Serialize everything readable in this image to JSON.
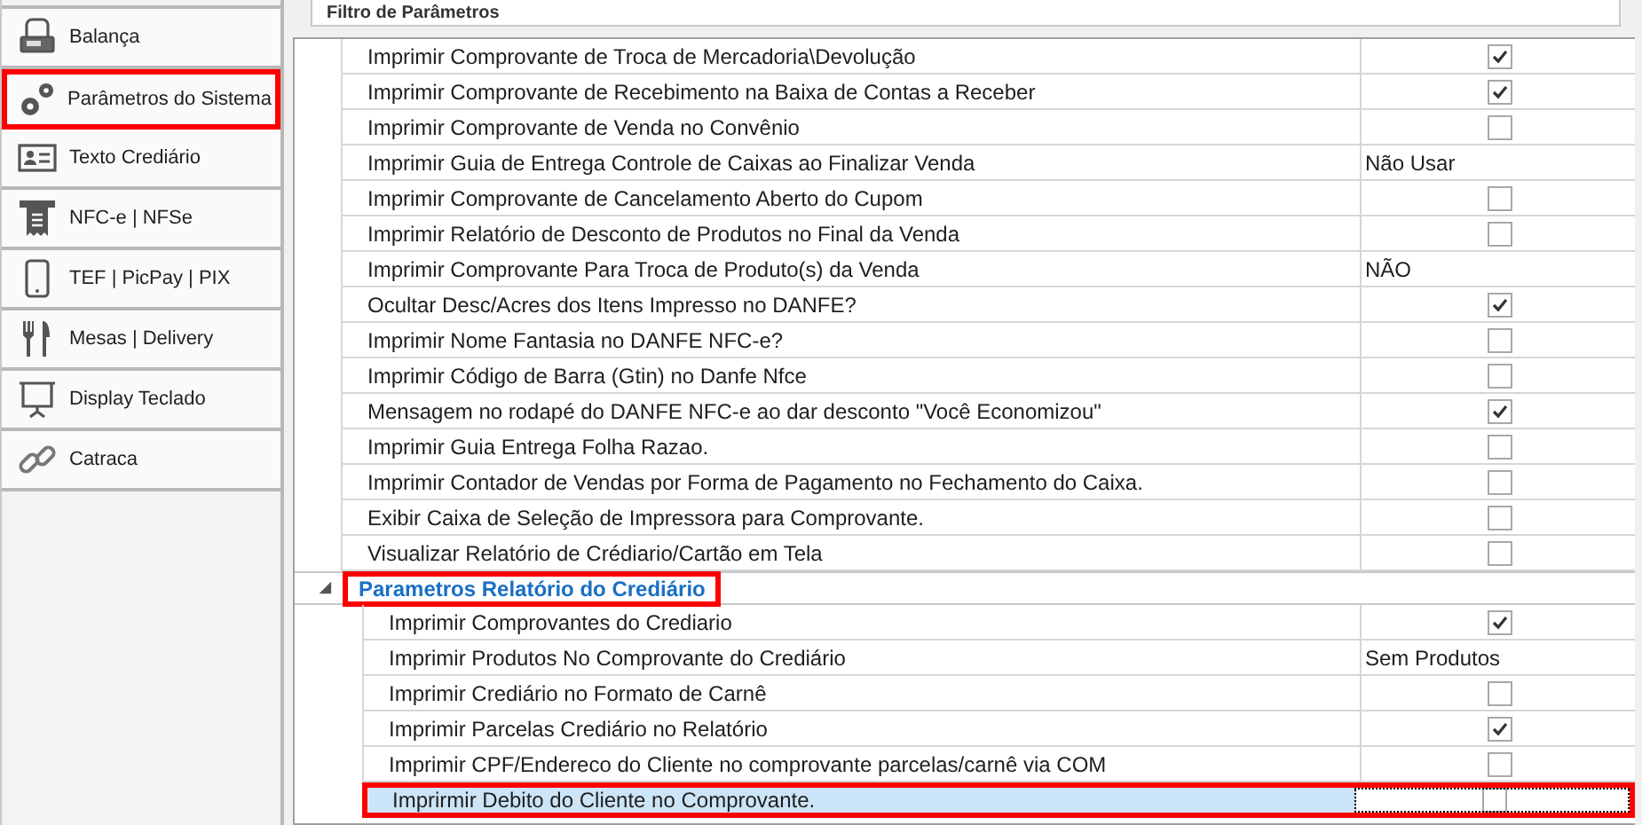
{
  "sidebar": {
    "items": [
      {
        "label": "Balança",
        "highlighted": false
      },
      {
        "label": "Parâmetros do Sistema",
        "highlighted": true
      },
      {
        "label": "Texto Crediário",
        "highlighted": false
      },
      {
        "label": "NFC-e | NFSe",
        "highlighted": false
      },
      {
        "label": "TEF | PicPay | PIX",
        "highlighted": false
      },
      {
        "label": "Mesas | Delivery",
        "highlighted": false
      },
      {
        "label": "Display Teclado",
        "highlighted": false
      },
      {
        "label": "Catraca",
        "highlighted": false
      }
    ]
  },
  "filter": {
    "title": "Filtro de Parâmetros"
  },
  "parameters": [
    {
      "kind": "check",
      "label": "Imprimir Comprovante de Troca de Mercadoria\\Devolução",
      "checked": true,
      "selected": false
    },
    {
      "kind": "check",
      "label": "Imprimir Comprovante de Recebimento na Baixa de Contas a Receber",
      "checked": true,
      "selected": false
    },
    {
      "kind": "check",
      "label": "Imprimir Comprovante de Venda no Convênio",
      "checked": false,
      "selected": false
    },
    {
      "kind": "text",
      "label": "Imprimir Guia de Entrega Controle de Caixas ao Finalizar Venda",
      "value": "Não Usar",
      "selected": false
    },
    {
      "kind": "check",
      "label": "Imprimir Comprovante de Cancelamento Aberto do Cupom",
      "checked": false,
      "selected": false
    },
    {
      "kind": "check",
      "label": "Imprimir Relatório de Desconto de Produtos no Final da Venda",
      "checked": false,
      "selected": false
    },
    {
      "kind": "text",
      "label": "Imprimir Comprovante Para Troca de Produto(s) da Venda",
      "value": "NÃO",
      "selected": false
    },
    {
      "kind": "check",
      "label": "Ocultar Desc/Acres dos Itens Impresso no DANFE?",
      "checked": true,
      "selected": false
    },
    {
      "kind": "check",
      "label": "Imprimir Nome Fantasia no DANFE NFC-e?",
      "checked": false,
      "selected": false
    },
    {
      "kind": "check",
      "label": "Imprimir Código de Barra (Gtin) no Danfe Nfce",
      "checked": false,
      "selected": false
    },
    {
      "kind": "check",
      "label": "Mensagem no rodapé do DANFE NFC-e ao dar desconto \"Você Economizou\"",
      "checked": true,
      "selected": false
    },
    {
      "kind": "check",
      "label": "Imprimir Guia Entrega Folha Razao.",
      "checked": false,
      "selected": false
    },
    {
      "kind": "check",
      "label": "Imprimir Contador de Vendas por Forma de Pagamento no Fechamento do Caixa.",
      "checked": false,
      "selected": false
    },
    {
      "kind": "check",
      "label": "Exibir Caixa de Seleção de Impressora para Comprovante.",
      "checked": false,
      "selected": false
    },
    {
      "kind": "check",
      "label": "Visualizar Relatório de Crédiario/Cartão em Tela",
      "checked": false,
      "selected": false
    },
    {
      "kind": "group",
      "label": "Parametros Relatório do Crediário",
      "expanded": true,
      "highlighted": true,
      "children": [
        {
          "kind": "check",
          "label": "Imprimir Comprovantes do Crediario",
          "checked": true,
          "selected": false,
          "highlighted": false
        },
        {
          "kind": "text",
          "label": "Imprimir Produtos No Comprovante do Crediário",
          "value": "Sem Produtos",
          "selected": false,
          "highlighted": false
        },
        {
          "kind": "check",
          "label": "Imprimir Crediário no Formato de Carnê",
          "checked": false,
          "selected": false,
          "highlighted": false
        },
        {
          "kind": "check",
          "label": "Imprimir Parcelas Crediário no Relatório",
          "checked": true,
          "selected": false,
          "highlighted": false
        },
        {
          "kind": "check",
          "label": "Imprimir CPF/Endereco do Cliente no comprovante parcelas/carnê via COM",
          "checked": false,
          "selected": false,
          "highlighted": false
        },
        {
          "kind": "check",
          "label": "Imprirmir Debito do Cliente no Comprovante.",
          "checked": false,
          "selected": true,
          "highlighted": true
        }
      ]
    }
  ]
}
